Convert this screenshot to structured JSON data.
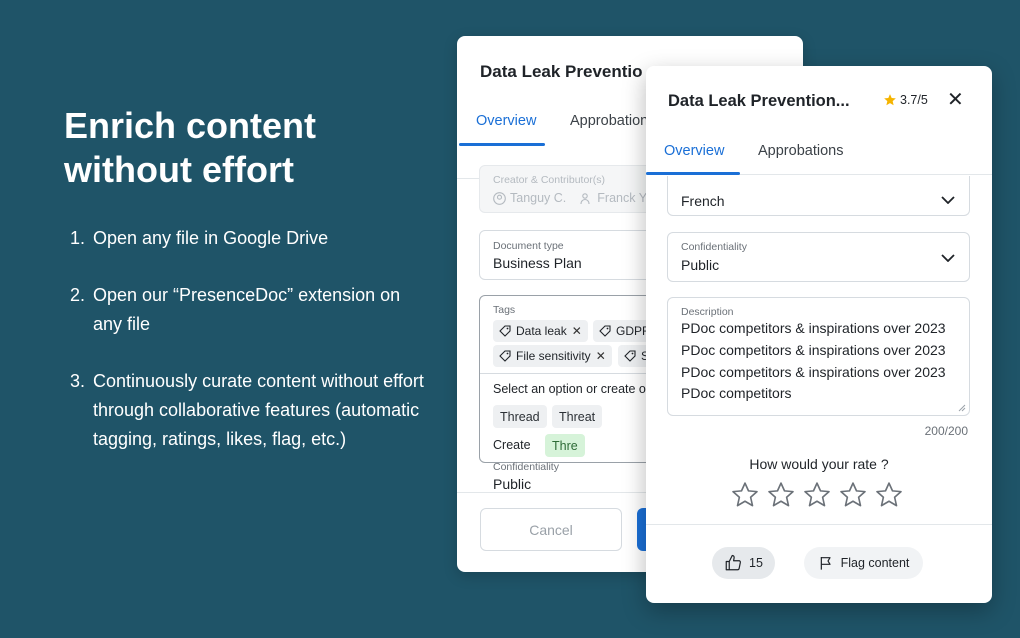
{
  "promo": {
    "headline_line1": "Enrich content",
    "headline_line2": "without effort",
    "steps": [
      {
        "num": "1.",
        "text": "Open any file in Google Drive"
      },
      {
        "num": "2.",
        "text": "Open our “PresenceDoc” extension on any file"
      },
      {
        "num": "3.",
        "text": "Continuously curate content without effort through collaborative features (automatic tagging, ratings, likes, flag, etc.)"
      }
    ]
  },
  "back_panel": {
    "title": "Data Leak Preventio",
    "tabs": [
      "Overview",
      "Approbation"
    ],
    "creator_label": "Creator & Contributor(s)",
    "creator_1": "Tanguy C.",
    "creator_2": "Franck Y",
    "doc_type_label": "Document type",
    "doc_type_value": "Business Plan",
    "tags_label": "Tags",
    "tags": [
      "Data leak",
      "GDPR",
      "File sensitivity",
      "S"
    ],
    "dropdown_prompt": "Select an option or create o",
    "options": [
      "Thread",
      "Threat"
    ],
    "create_label": "Create",
    "create_value": "Thre",
    "confidentiality_label": "Confidentiality",
    "confidentiality_value": "Public",
    "cancel_label": "Cancel"
  },
  "front_panel": {
    "title": "Data Leak Prevention...",
    "rating": "3.7/5",
    "tabs": [
      "Overview",
      "Approbations"
    ],
    "language_value": "French",
    "confidentiality_label": "Confidentiality",
    "confidentiality_value": "Public",
    "description_label": "Description",
    "description_text": "PDoc competitors & inspirations over 2023 PDoc competitors & inspirations over 2023 PDoc competitors & inspirations over 2023 PDoc competitors",
    "char_counter": "200/200",
    "rate_question": "How would your rate ?",
    "stars_filled": 0,
    "stars_total": 5,
    "likes": "15",
    "flag_label": "Flag content"
  },
  "colors": {
    "background": "#1f5468",
    "accent": "#1a6fd6",
    "star_gold": "#f5b400"
  }
}
